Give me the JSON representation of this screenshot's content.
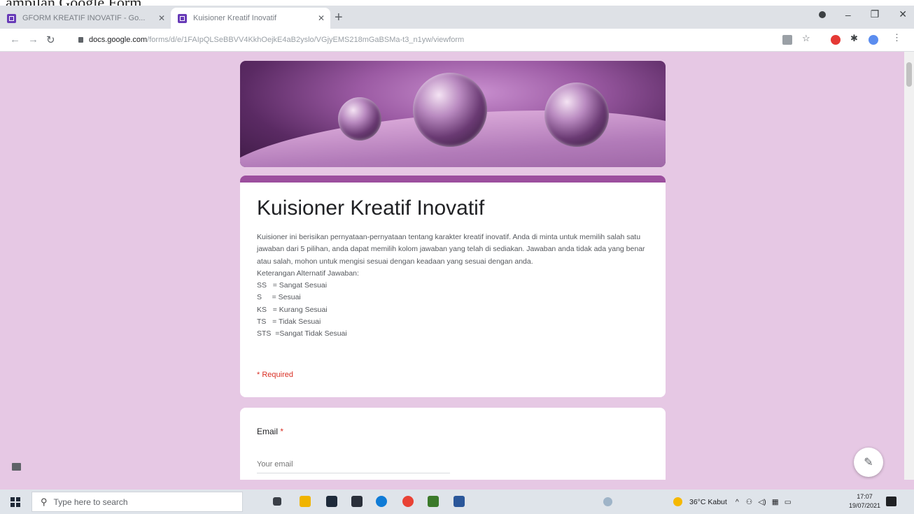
{
  "cropped_text": "ampilan Google Form",
  "browser": {
    "tabs": [
      {
        "title": "GFORM KREATIF INOVATIF - Go...",
        "active": false
      },
      {
        "title": "Kuisioner Kreatif Inovatif",
        "active": true
      }
    ],
    "url_host": "docs.google.com",
    "url_path": "/forms/d/e/1FAIpQLSeBBVV4KkhOejkE4aB2yslo/VGjyEMS218mGaBSMa-t3_n1yw/viewform"
  },
  "form": {
    "title": "Kuisioner Kreatif Inovatif",
    "description": "Kuisioner ini berisikan pernyataan-pernyataan tentang karakter kreatif inovatif. Anda di minta untuk memilih salah satu jawaban dari 5 pilihan, anda dapat memilih kolom jawaban yang telah di sediakan. Jawaban anda tidak ada yang benar atau salah, mohon untuk mengisi sesuai dengan keadaan yang sesuai dengan anda.\nKeterangan Alternatif Jawaban:\nSS   = Sangat Sesuai\nS     = Sesuai\nKS   = Kurang Sesuai\nTS   = Tidak Sesuai\nSTS  =Sangat Tidak Sesuai",
    "required_note": "* Required",
    "email_label": "Email",
    "required_star": "*",
    "email_placeholder": "Your email"
  },
  "taskbar": {
    "search_placeholder": "Type here to search",
    "weather": "36°C  Kabut",
    "time": "17:07",
    "date": "19/07/2021"
  },
  "colors": {
    "page_bg": "#e6c8e4",
    "accent": "#9c4f9e",
    "required": "#d93025"
  }
}
